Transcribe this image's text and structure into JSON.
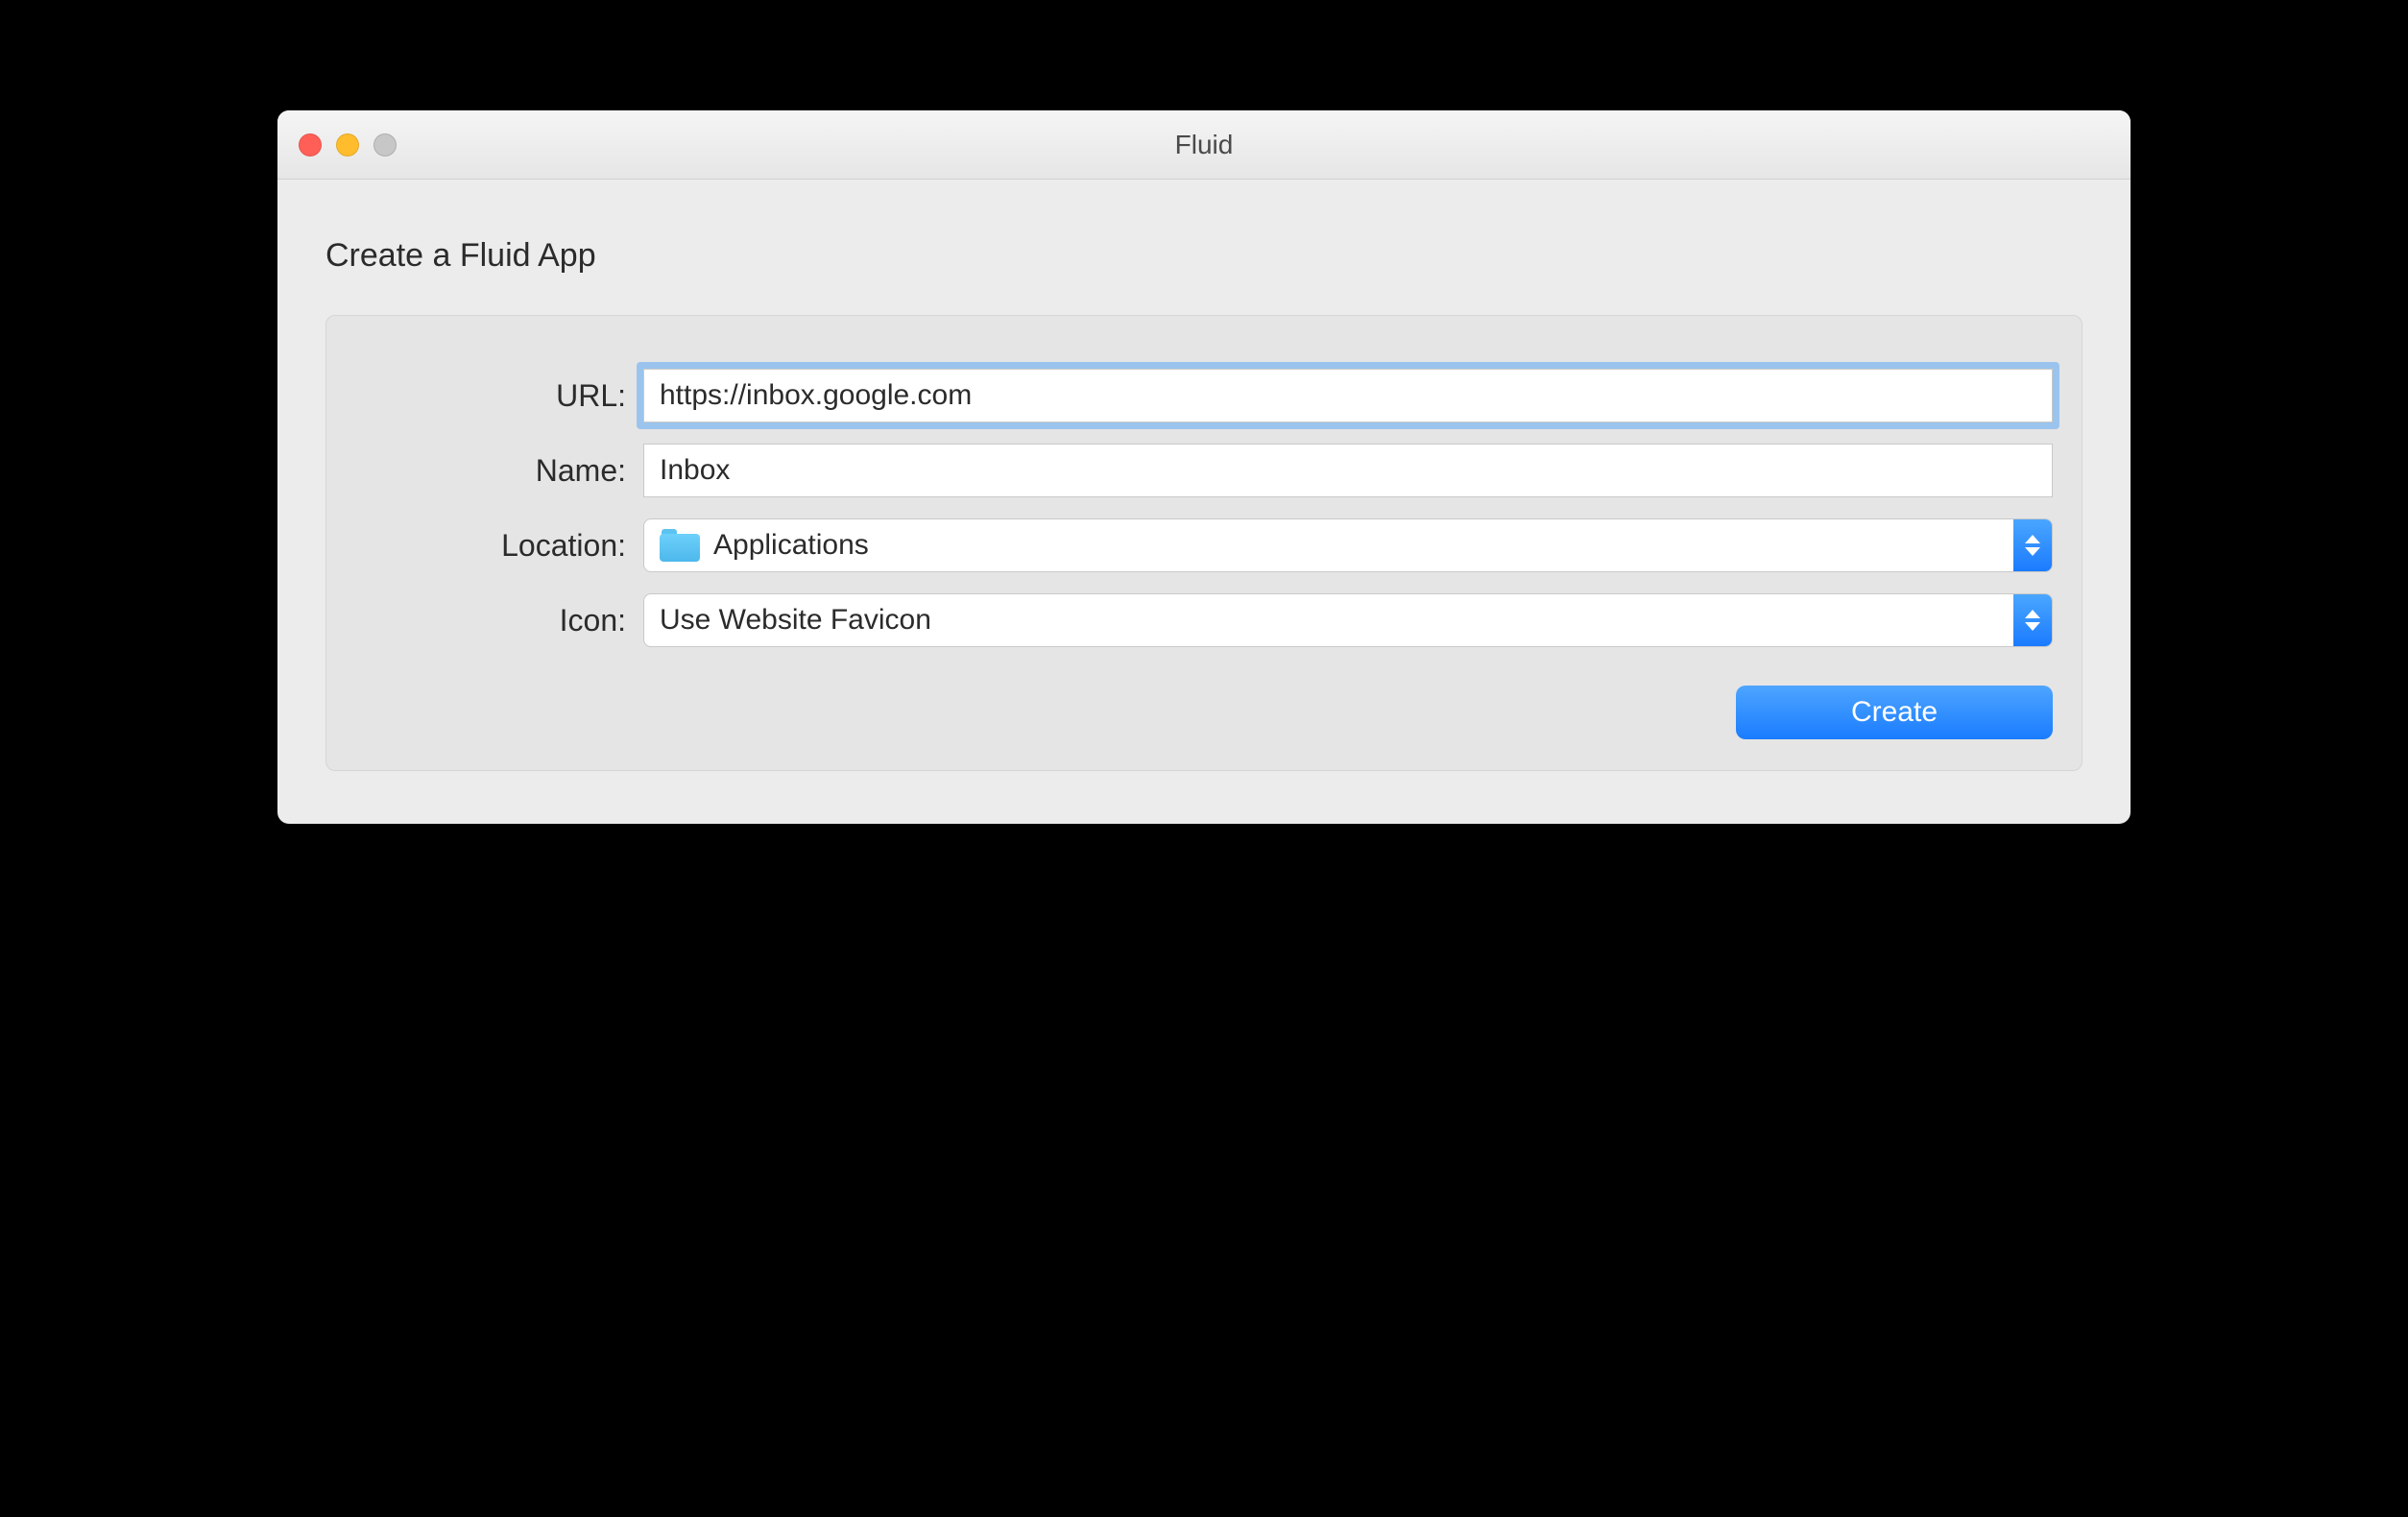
{
  "window": {
    "title": "Fluid"
  },
  "heading": "Create a Fluid App",
  "form": {
    "url": {
      "label": "URL:",
      "value": "https://inbox.google.com"
    },
    "name": {
      "label": "Name:",
      "value": "Inbox"
    },
    "location": {
      "label": "Location:",
      "value": "Applications"
    },
    "icon": {
      "label": "Icon:",
      "value": "Use Website Favicon"
    }
  },
  "buttons": {
    "create": "Create"
  }
}
